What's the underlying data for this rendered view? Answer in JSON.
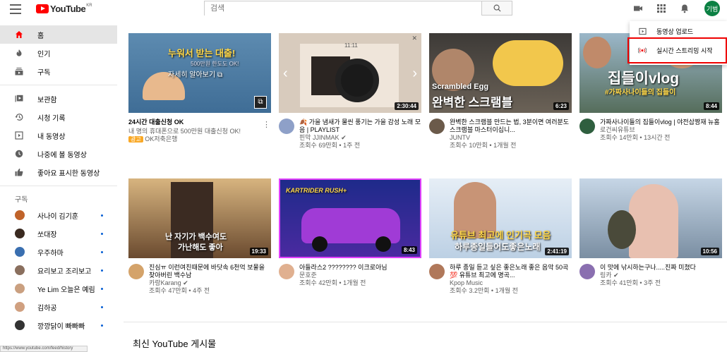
{
  "header": {
    "logo_text": "YouTube",
    "logo_region": "KR",
    "search_placeholder": "검색",
    "avatar_text": "기범"
  },
  "sidebar": {
    "main_items": [
      {
        "label": "홈",
        "icon": "home-icon"
      },
      {
        "label": "인기",
        "icon": "trending-icon"
      },
      {
        "label": "구독",
        "icon": "subscriptions-icon"
      }
    ],
    "library_items": [
      {
        "label": "보관함",
        "icon": "library-icon"
      },
      {
        "label": "시청 기록",
        "icon": "history-icon"
      },
      {
        "label": "내 동영상",
        "icon": "your-videos-icon"
      },
      {
        "label": "나중에 볼 동영상",
        "icon": "watch-later-icon"
      },
      {
        "label": "좋아요 표시한 동영상",
        "icon": "liked-icon"
      }
    ],
    "subscriptions_heading": "구독",
    "subscriptions": [
      {
        "label": "사나이 김기훈",
        "color": "#c0632a"
      },
      {
        "label": "쏘대장",
        "color": "#3a2a20"
      },
      {
        "label": "우주하마",
        "color": "#3a6fb0"
      },
      {
        "label": "요리보고 조리보고",
        "color": "#8a6f5e"
      },
      {
        "label": "Ye Lim 오늘은 예림",
        "color": "#caa080"
      },
      {
        "label": "김하공",
        "color": "#d0a080"
      },
      {
        "label": "깡깡닭이 빠빠빠",
        "color": "#333333"
      }
    ]
  },
  "menu": {
    "upload": "동영상 업로드",
    "live": "실시간 스트리밍 시작"
  },
  "videos": [
    {
      "title": "24시간 대출신청 OK",
      "channel": "내 명의 휴대폰으로 500만원 대출신청 OK!",
      "stats": "OK저축은행",
      "badge": "광고",
      "duration": "",
      "avatar_color": ""
    },
    {
      "title": "🍂 가을 냄새가 물씬 풍기는 가을 감성 노래 모음 | PLAYLIST",
      "channel": "핀막 JJINMAK ✔",
      "stats": "조회수 69만회 • 1주 전",
      "duration": "2:30:44",
      "avatar_color": "#8ea0c8"
    },
    {
      "title": "완벽한 스크램블 만드는 법, 3분이면 여러분도 스크램블 마스터이십니...",
      "channel": "JUNTV",
      "stats": "조회수 10만회 • 1개월 전",
      "duration": "6:23",
      "avatar_color": "#6b5a4a"
    },
    {
      "title": "가짜사나이들의 집들이vlog | 야전삽짱재 뉴홈",
      "channel": "로건씨유튜브",
      "stats": "조회수 14만회 • 13시간 전",
      "duration": "8:44",
      "avatar_color": "#2f5f3f"
    },
    {
      "title": "진심ㅠ 이런여친때문에 바닷속 6천억 보물을 찾아버린 백수남",
      "channel": "카랑Karang ✔",
      "stats": "조회수 47만회 • 4주 전",
      "duration": "19:33",
      "avatar_color": "#d4a36a"
    },
    {
      "title": "아들라스2 ???????? 이크로아님",
      "channel": "문호준",
      "stats": "조회수 42만회 • 1개월 전",
      "duration": "8:43",
      "avatar_color": "#e0b090"
    },
    {
      "title": "하루 종일 듣고 싶은 좋은노래 좋은 음악 50곡 💯 유튜브 최고에 명곡...",
      "channel": "Kpop Music",
      "stats": "조회수 3.2만회 • 1개월 전",
      "duration": "2:41:19",
      "avatar_color": "#b0785a"
    },
    {
      "title": "이 맛에 낚시하는구나.....진짜 미쳤다",
      "channel": "링카 ✔",
      "stats": "조회수 41만회 • 3주 전",
      "duration": "10:56",
      "avatar_color": "#8a6fb0"
    }
  ],
  "thumbs": {
    "ad_line1": "누워서 받는 대출!",
    "ad_line2": "500만원 한도도 OK!",
    "ad_cta": "자세히 알아보기",
    "egg_line1": "Scrambled Egg",
    "egg_line2": "완벽한 스크램블",
    "vlog_line1": "집들이vlog",
    "vlog_line2": "#가짜사나이들의 집들이",
    "ocean_line1": "난 자기가 백수여도",
    "ocean_line2": "가난해도 좋아",
    "kart_title": "KARTRIDER RUSH+",
    "music_line1": "유튜브 최고에 인기곡 모음",
    "music_line2": "하루종일들어도좋은노래",
    "playlist_time": "11:11"
  },
  "posts_title": "최신 YouTube 게시물",
  "status_url": "https://www.youtube.com/feed/history"
}
